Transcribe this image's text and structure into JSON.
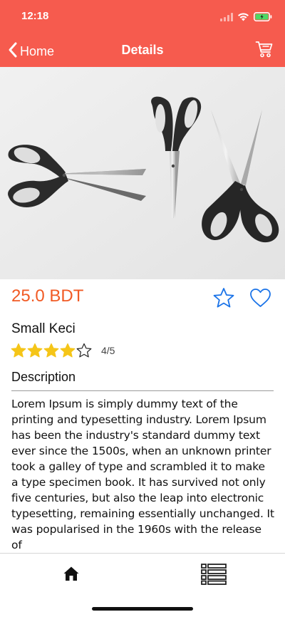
{
  "status_bar": {
    "time": "12:18"
  },
  "nav": {
    "back_label": "Home",
    "title": "Details"
  },
  "product": {
    "price": "25.0 BDT",
    "name": "Small Keci",
    "rating": 4,
    "rating_max": 5,
    "rating_text": "4/5"
  },
  "description": {
    "heading": "Description",
    "body": "Lorem Ipsum is simply dummy text of the printing and typesetting industry. Lorem Ipsum has been the industry's standard dummy text ever since the 1500s, when an unknown printer took a galley of type and scrambled it to make a type specimen book. It has survived not only five centuries, but also the leap into electronic typesetting, remaining essentially unchanged. It was popularised in the 1960s with the release of"
  },
  "icons": {
    "back": "chevron-left-icon",
    "cart": "cart-icon",
    "favorite_star": "star-outline-icon",
    "favorite_heart": "heart-outline-icon",
    "tab_home": "home-icon",
    "tab_list": "list-icon"
  },
  "colors": {
    "header": "#f65b4e",
    "price": "#f15a24",
    "accent_blue": "#1a73e8",
    "star_fill": "#f5c518",
    "battery": "#4cd964"
  }
}
